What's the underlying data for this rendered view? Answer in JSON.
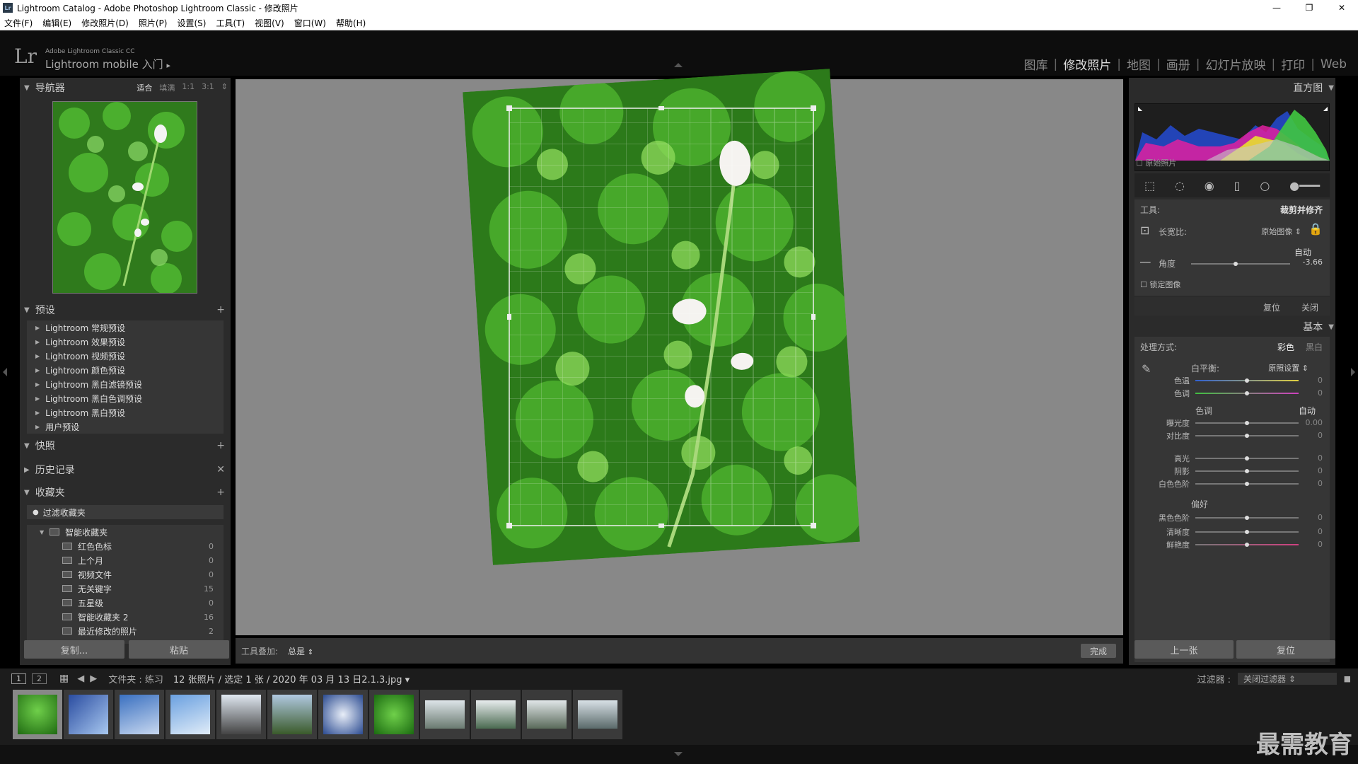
{
  "window": {
    "title": "Lightroom Catalog - Adobe Photoshop Lightroom Classic - 修改照片",
    "minimize": "—",
    "restore": "❐",
    "close": "✕",
    "app_badge": "Lr"
  },
  "menu": [
    "文件(F)",
    "编辑(E)",
    "修改照片(D)",
    "照片(P)",
    "设置(S)",
    "工具(T)",
    "视图(V)",
    "窗口(W)",
    "帮助(H)"
  ],
  "identity": {
    "logo": "Lr",
    "line1": "Adobe Lightroom Classic CC",
    "line2": "Lightroom mobile 入门",
    "arrow": "▸"
  },
  "modules": [
    "图库",
    "修改照片",
    "地图",
    "画册",
    "幻灯片放映",
    "打印",
    "Web"
  ],
  "active_module": "修改照片",
  "navigator": {
    "title": "导航器",
    "options": [
      "适合",
      "填满",
      "1:1",
      "3:1"
    ]
  },
  "presets": {
    "title": "预设",
    "items": [
      "Lightroom 常规预设",
      "Lightroom 效果预设",
      "Lightroom 视频预设",
      "Lightroom 颜色预设",
      "Lightroom 黑白滤镜预设",
      "Lightroom 黑白色调预设",
      "Lightroom 黑白预设",
      "用户预设"
    ]
  },
  "snapshots": {
    "title": "快照"
  },
  "history": {
    "title": "历史记录"
  },
  "collections": {
    "title": "收藏夹",
    "filter": "过滤收藏夹",
    "smart_folder": "智能收藏夹",
    "items": [
      {
        "name": "红色色标",
        "count": "0"
      },
      {
        "name": "上个月",
        "count": "0"
      },
      {
        "name": "视频文件",
        "count": "0"
      },
      {
        "name": "无关键字",
        "count": "15"
      },
      {
        "name": "五星级",
        "count": "0"
      },
      {
        "name": "智能收藏夹 2",
        "count": "16"
      },
      {
        "name": "最近修改的照片",
        "count": "2"
      }
    ]
  },
  "left_buttons": {
    "copy": "复制...",
    "paste": "粘贴"
  },
  "toolbar": {
    "overlay_label": "工具叠加:",
    "overlay_value": "总是",
    "done": "完成"
  },
  "histogram": {
    "title": "直方图",
    "original_label": "原始照片"
  },
  "crop": {
    "tool_label": "工具:",
    "tool_name": "裁剪并修齐",
    "aspect_label": "长宽比:",
    "aspect_value": "原始图像",
    "auto": "自动",
    "angle_label": "角度",
    "angle_value": "-3.66",
    "angle_fraction": 0.45,
    "lock_label": "锁定图像",
    "reset": "复位",
    "close": "关闭"
  },
  "basic": {
    "title": "基本",
    "treatment_label": "处理方式:",
    "color": "彩色",
    "bw": "黑白",
    "wb_label": "白平衡:",
    "wb_value": "原照设置",
    "tone_label": "色调",
    "tone_auto": "自动",
    "presence_label": "偏好",
    "sliders": [
      {
        "name": "色温",
        "value": "0"
      },
      {
        "name": "色调",
        "value": "0"
      },
      {
        "name": "曝光度",
        "value": "0.00"
      },
      {
        "name": "对比度",
        "value": "0"
      },
      {
        "name": "高光",
        "value": "0"
      },
      {
        "name": "阴影",
        "value": "0"
      },
      {
        "name": "白色色阶",
        "value": "0"
      },
      {
        "name": "黑色色阶",
        "value": "0"
      },
      {
        "name": "清晰度",
        "value": "0"
      },
      {
        "name": "鲜艳度",
        "value": "0"
      }
    ]
  },
  "right_buttons": {
    "prev": "上一张",
    "reset": "复位"
  },
  "filmbar": {
    "view1": "1",
    "view2": "2",
    "source": "文件夹 : 练习",
    "info": "12 张照片 / 选定 1 张 / 2020 年 03 月 13 日2.1.3.jpg",
    "filter_label": "过滤器 :",
    "filter_value": "关闭过滤器"
  },
  "watermark": "最需教育",
  "colors": {
    "panel": "#2b2b2b",
    "center": "#888888",
    "accent": "#dddddd"
  }
}
